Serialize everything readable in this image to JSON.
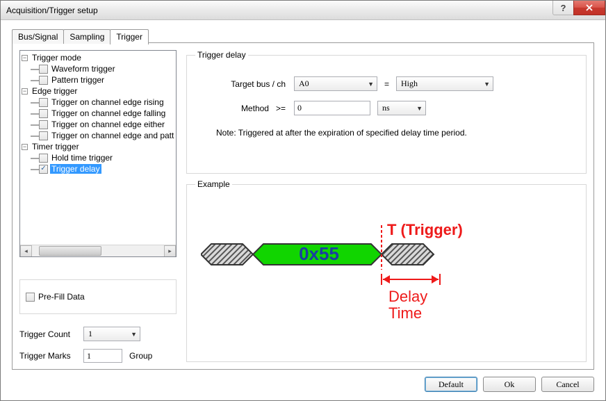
{
  "window": {
    "title": "Acquisition/Trigger setup"
  },
  "tabs": [
    "Bus/Signal",
    "Sampling",
    "Trigger"
  ],
  "active_tab": 2,
  "tree": {
    "trigger_mode": {
      "label": "Trigger mode",
      "children": {
        "waveform": {
          "label": "Waveform trigger",
          "checked": false
        },
        "pattern": {
          "label": "Pattern trigger",
          "checked": false
        }
      }
    },
    "edge_trigger": {
      "label": "Edge trigger",
      "children": {
        "rising": {
          "label": "Trigger on channel edge rising",
          "checked": false
        },
        "falling": {
          "label": "Trigger on channel edge falling",
          "checked": false
        },
        "either": {
          "label": "Trigger on channel edge either",
          "checked": false
        },
        "patt": {
          "label": "Trigger on channel edge and patt",
          "checked": false
        }
      }
    },
    "timer_trigger": {
      "label": "Timer trigger",
      "children": {
        "hold": {
          "label": "Hold time trigger",
          "checked": false
        },
        "delay": {
          "label": "Trigger delay",
          "checked": true,
          "selected": true
        }
      }
    }
  },
  "prefill": {
    "label": "Pre-Fill Data",
    "checked": false
  },
  "trigger_count": {
    "label": "Trigger Count",
    "value": "1"
  },
  "trigger_marks": {
    "label": "Trigger Marks",
    "value": "1",
    "unit": "Group"
  },
  "delay_group": {
    "legend": "Trigger delay",
    "target_label": "Target bus / ch",
    "target_value": "A0",
    "equals": "=",
    "level_value": "High",
    "method_label": "Method",
    "method_op": ">=",
    "method_value": "0",
    "method_unit": "ns",
    "note": "Note: Triggered at after the expiration of specified delay time period."
  },
  "example": {
    "legend": "Example",
    "trigger_label": "T (Trigger)",
    "data_value": "0x55",
    "delay_label_line1": "Delay",
    "delay_label_line2": "Time"
  },
  "buttons": {
    "default": "Default",
    "ok": "Ok",
    "cancel": "Cancel"
  }
}
